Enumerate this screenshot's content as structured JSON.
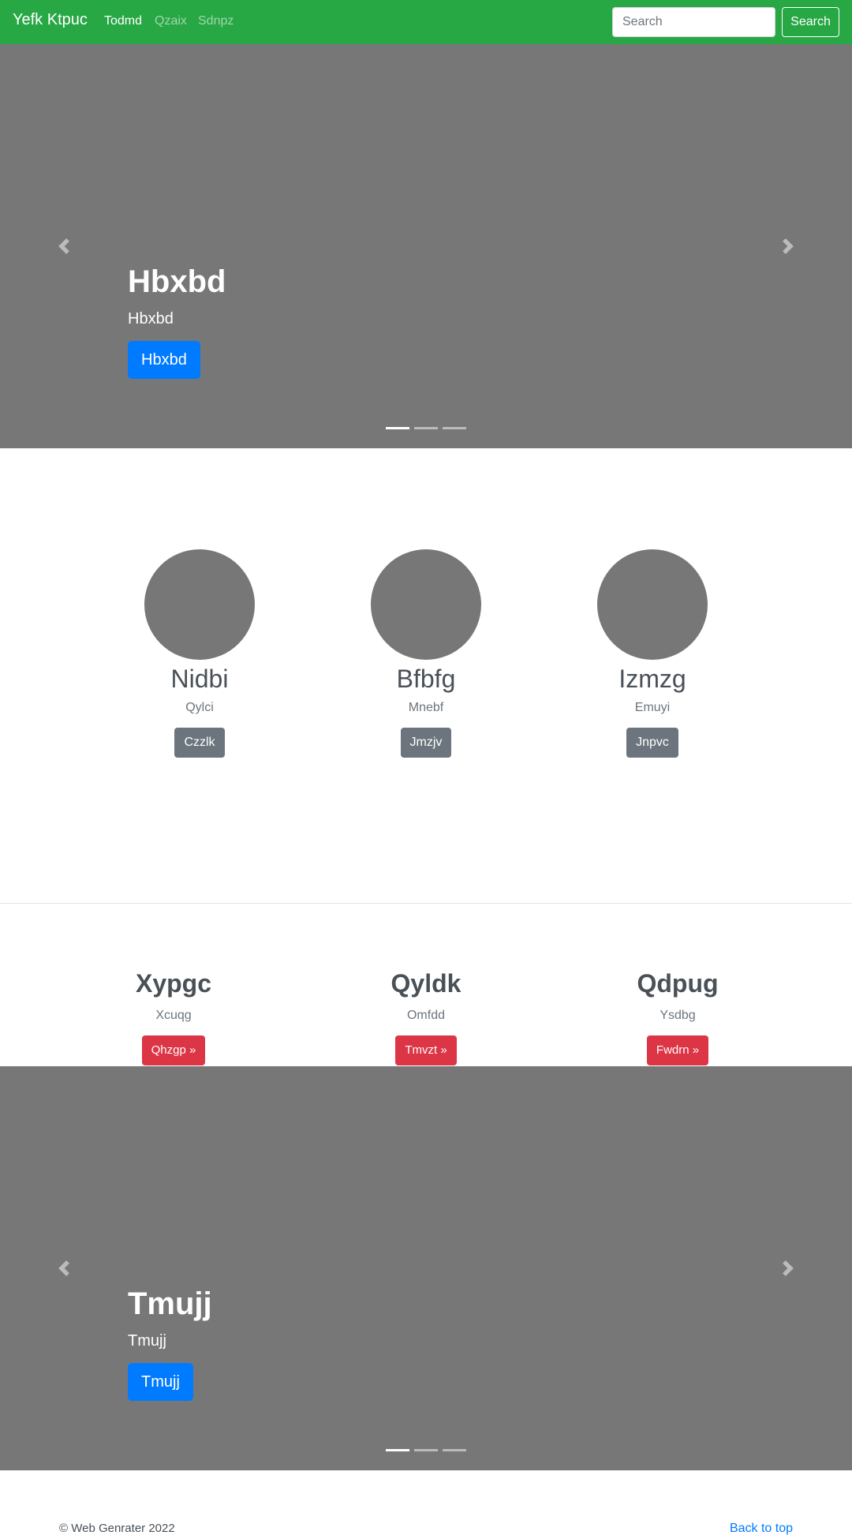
{
  "navbar": {
    "brand": "Yefk Ktpuc",
    "links": [
      "Todmd",
      "Qzaix",
      "Sdnpz"
    ],
    "search_placeholder": "Search",
    "search_button": "Search",
    "background": "#28a745"
  },
  "carousel_1": {
    "heading": "Hbxbd",
    "text": "Hbxbd",
    "button": "Hbxbd",
    "indicator_count": 3,
    "active_indicator": 1,
    "prev_icon": "chevron-left-icon",
    "next_icon": "chevron-right-icon"
  },
  "marketing": {
    "items": [
      {
        "heading": "Nidbi",
        "text": "Qylci",
        "button": "Czzlk"
      },
      {
        "heading": "Bfbfg",
        "text": "Mnebf",
        "button": "Jmzjv"
      },
      {
        "heading": "Izmzg",
        "text": "Emuyi",
        "button": "Jnpvc"
      }
    ]
  },
  "features": {
    "items": [
      {
        "heading": "Xypgc",
        "text": "Xcuqg",
        "button": "Qhzgp »"
      },
      {
        "heading": "Qyldk",
        "text": "Omfdd",
        "button": "Tmvzt »"
      },
      {
        "heading": "Qdpug",
        "text": "Ysdbg",
        "button": "Fwdrn »"
      }
    ]
  },
  "carousel_2": {
    "heading": "Tmujj",
    "text": "Tmujj",
    "button": "Tmujj",
    "indicator_count": 3,
    "active_indicator": 1,
    "prev_icon": "chevron-left-icon",
    "next_icon": "chevron-right-icon"
  },
  "footer": {
    "copyright": "© Web Genrater 2022",
    "back_to_top": "Back to top"
  },
  "colors": {
    "primary": "#007bff",
    "secondary": "#6c757d",
    "danger": "#dc3545",
    "placeholder_gray": "#777777"
  }
}
